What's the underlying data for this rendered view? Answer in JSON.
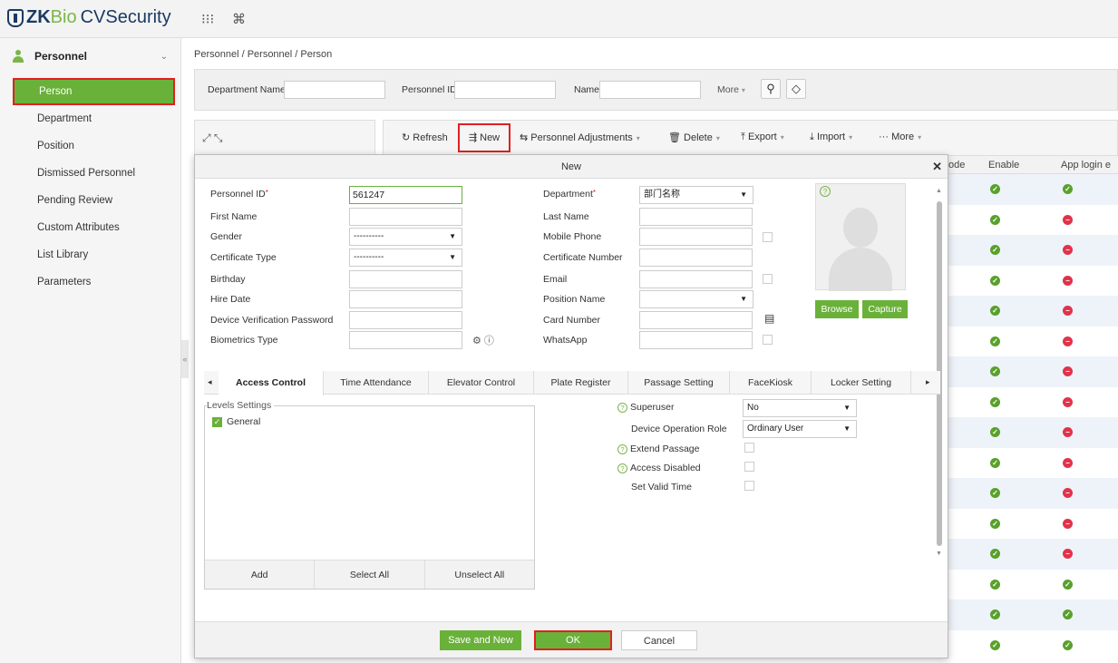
{
  "app": {
    "logo_zk": "ZK",
    "logo_bio": "Bio",
    "logo_rest": "CVSecurity"
  },
  "sidebar": {
    "module": "Personnel",
    "items": [
      {
        "label": "Person"
      },
      {
        "label": "Department"
      },
      {
        "label": "Position"
      },
      {
        "label": "Dismissed Personnel"
      },
      {
        "label": "Pending Review"
      },
      {
        "label": "Custom Attributes"
      },
      {
        "label": "List Library"
      },
      {
        "label": "Parameters"
      }
    ]
  },
  "breadcrumb": "Personnel / Personnel / Person",
  "filters": {
    "department_name": "Department Name",
    "personnel_id": "Personnel ID",
    "name": "Name",
    "more": "More"
  },
  "toolbar": {
    "refresh": "Refresh",
    "new": "New",
    "adjustments": "Personnel Adjustments",
    "delete": "Delete",
    "export": "Export",
    "import": "Import",
    "more": "More"
  },
  "table": {
    "col_ode": "ode",
    "col_enable": "Enable",
    "col_app": "App login e",
    "rows": [
      {
        "enable": true,
        "app": true
      },
      {
        "enable": true,
        "app": false
      },
      {
        "enable": true,
        "app": false
      },
      {
        "enable": true,
        "app": false
      },
      {
        "enable": true,
        "app": false
      },
      {
        "enable": true,
        "app": false
      },
      {
        "enable": true,
        "app": false
      },
      {
        "enable": true,
        "app": false
      },
      {
        "enable": true,
        "app": false
      },
      {
        "enable": true,
        "app": false
      },
      {
        "enable": true,
        "app": false
      },
      {
        "enable": true,
        "app": false
      },
      {
        "enable": true,
        "app": false
      },
      {
        "enable": true,
        "app": true
      },
      {
        "enable": true,
        "app": true
      },
      {
        "enable": true,
        "app": true
      }
    ]
  },
  "modal": {
    "title": "New",
    "left_fields": {
      "personnel_id_label": "Personnel ID",
      "personnel_id_value": "561247",
      "first_name_label": "First Name",
      "gender_label": "Gender",
      "gender_value": "----------",
      "cert_type_label": "Certificate Type",
      "cert_type_value": "----------",
      "birthday_label": "Birthday",
      "hire_date_label": "Hire Date",
      "dev_pwd_label": "Device Verification Password",
      "bio_type_label": "Biometrics Type"
    },
    "right_fields": {
      "department_label": "Department",
      "department_value": "部门名称",
      "last_name_label": "Last Name",
      "mobile_label": "Mobile Phone",
      "cert_num_label": "Certificate Number",
      "email_label": "Email",
      "position_label": "Position Name",
      "card_label": "Card Number",
      "whatsapp_label": "WhatsApp"
    },
    "photo": {
      "browse": "Browse",
      "capture": "Capture"
    },
    "tabs": [
      {
        "label": "Access Control"
      },
      {
        "label": "Time Attendance"
      },
      {
        "label": "Elevator Control"
      },
      {
        "label": "Plate Register"
      },
      {
        "label": "Passage Setting"
      },
      {
        "label": "FaceKiosk"
      },
      {
        "label": "Locker Setting"
      }
    ],
    "levels": {
      "legend": "Levels Settings",
      "item": "General",
      "add": "Add",
      "select_all": "Select All",
      "unselect_all": "Unselect All"
    },
    "access": {
      "superuser_label": "Superuser",
      "superuser_value": "No",
      "role_label": "Device Operation Role",
      "role_value": "Ordinary User",
      "extend_label": "Extend Passage",
      "disabled_label": "Access Disabled",
      "valid_time_label": "Set Valid Time"
    },
    "buttons": {
      "save_new": "Save and New",
      "ok": "OK",
      "cancel": "Cancel"
    }
  },
  "colors": {
    "accent": "#6ab13a",
    "highlight": "#e02020",
    "brand": "#1a3a63"
  }
}
